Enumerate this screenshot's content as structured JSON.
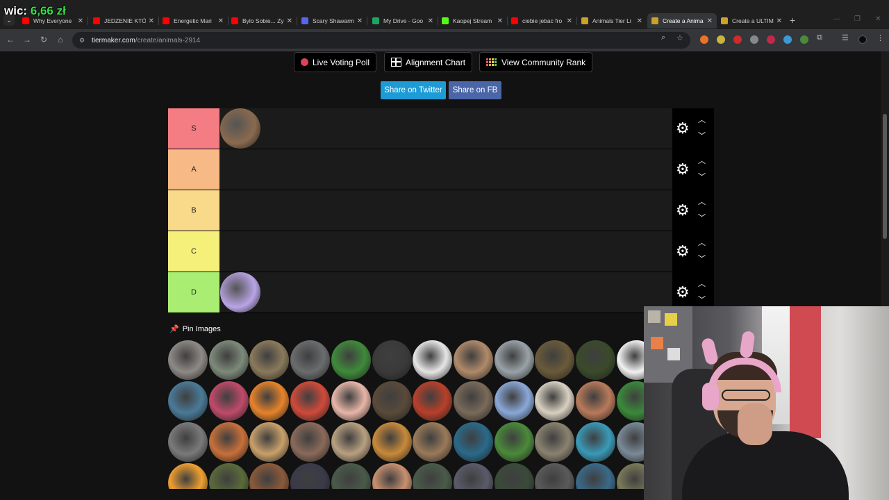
{
  "overlay": {
    "label": "wic:",
    "amount": "6,66 zł"
  },
  "tabs": [
    {
      "title": "Why Everyone",
      "fav": "#ff0000"
    },
    {
      "title": "JEDZENIE KTÓR",
      "fav": "#ff0000"
    },
    {
      "title": "Energetic Mari",
      "fav": "#ff0000"
    },
    {
      "title": "Bylo Sobie... Zy",
      "fav": "#ff0000"
    },
    {
      "title": "Scary Shawarm",
      "fav": "#5865f2"
    },
    {
      "title": "My Drive - Goo",
      "fav": "#1fa463"
    },
    {
      "title": "Kaopej Stream",
      "fav": "#53fc18"
    },
    {
      "title": "ciebie jebac fro",
      "fav": "#ff0000"
    },
    {
      "title": "Animals Tier Li",
      "fav": "#c9a227"
    },
    {
      "title": "Create a Anima",
      "fav": "#c9a227"
    },
    {
      "title": "Create a ULTIM",
      "fav": "#c9a227"
    }
  ],
  "address": {
    "host": "tiermaker.com",
    "path": "/create/animals-2914"
  },
  "top_buttons": {
    "live": "Live Voting Poll",
    "alignment": "Alignment Chart",
    "community": "View Community Rank"
  },
  "share": {
    "twitter": "Share on Twitter",
    "fb": "Share on FB"
  },
  "tiers": [
    {
      "label": "S",
      "color": "#f47c83",
      "items": [
        "#8a6a4e"
      ]
    },
    {
      "label": "A",
      "color": "#f7b985",
      "items": []
    },
    {
      "label": "B",
      "color": "#f9d98a",
      "items": []
    },
    {
      "label": "C",
      "color": "#f5f07a",
      "items": []
    },
    {
      "label": "D",
      "color": "#a9ee72",
      "items": [
        "#b9a4e6"
      ]
    }
  ],
  "pin_label": "Pin Images",
  "icons": {
    "gear": "gear-icon",
    "up": "chevron-up-icon",
    "down": "chevron-down-icon",
    "pin": "pin-icon"
  },
  "pool_colors": [
    "#8e8a86",
    "#7d8a7a",
    "#8a7a5b",
    "#6a6c6e",
    "#3f8a3a",
    "#3a3a3a",
    "#e6e6e6",
    "#b08a6a",
    "#9aa2a8",
    "#6a5a3a",
    "#3a4a2a",
    "#f2f2f2",
    "#4a7a98",
    "#c04a6a",
    "#e7832a",
    "#d04a3a",
    "#e8b6a8",
    "#5a4a3a",
    "#b8402a",
    "#7a6a5a",
    "#8aa8d8",
    "#d8d0c0",
    "#b87a5a",
    "#3a8a3a",
    "#7a7a7a",
    "#c8703a",
    "#c8a06a",
    "#8a6a5a",
    "#b8a080",
    "#c88a3a",
    "#9a7a5a",
    "#2a6a8a",
    "#4a8a3a",
    "#8a8270",
    "#3a9ab8",
    "#7a8a98",
    "#f0a030",
    "#5a6a3a",
    "#8a5a3a",
    "#3a3a4a",
    "#4a5a4a",
    "#c89070",
    "#4a5a4a",
    "#5a5a6a",
    "#3a4a3a",
    "#5a5a5a",
    "#3a6a8a",
    "#7a7a5a"
  ]
}
